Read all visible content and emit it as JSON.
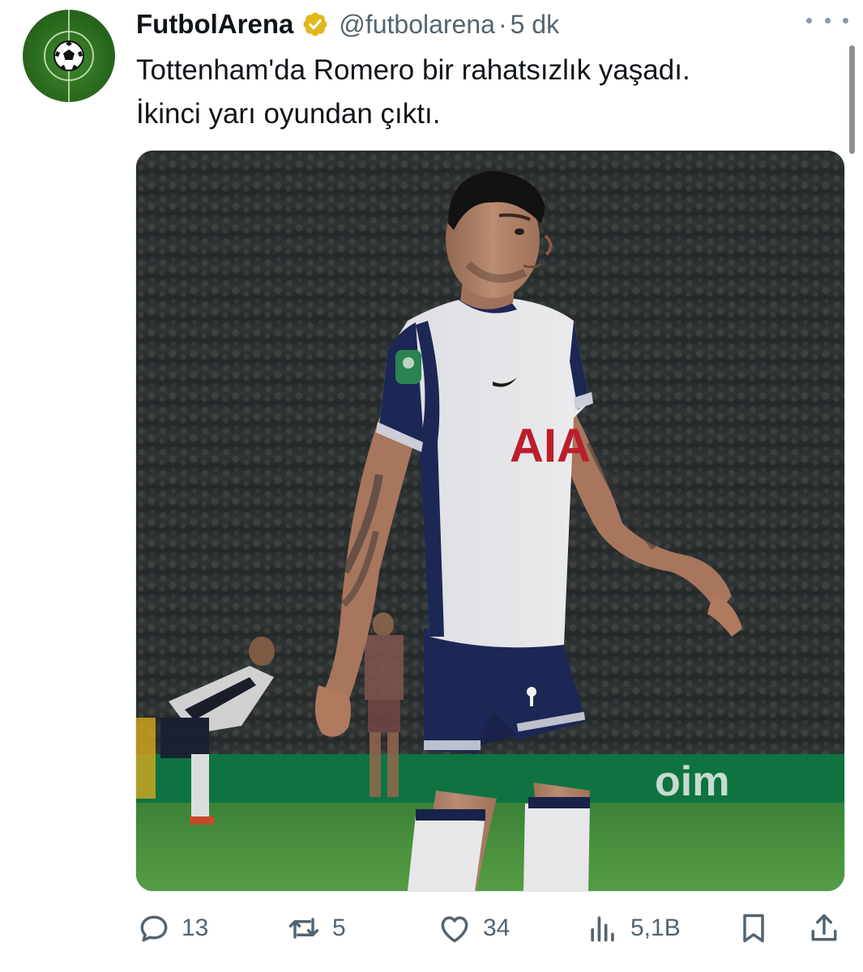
{
  "tweet": {
    "author_name": "FutbolArena",
    "handle": "@futbolarena",
    "separator": "·",
    "time": "5 dk",
    "text_line1": "Tottenham'da Romero bir rahatsızlık yaşadı.",
    "text_line2": "İkinci yarı oyundan çıktı.",
    "media_sponsor": "AIA"
  },
  "actions": {
    "replies": "13",
    "retweets": "5",
    "likes": "34",
    "views": "5,1B"
  },
  "colors": {
    "text_primary": "#0f1419",
    "text_secondary": "#536471",
    "verified_gold": "#e2b719",
    "avatar_green": "#2a6a1d"
  }
}
